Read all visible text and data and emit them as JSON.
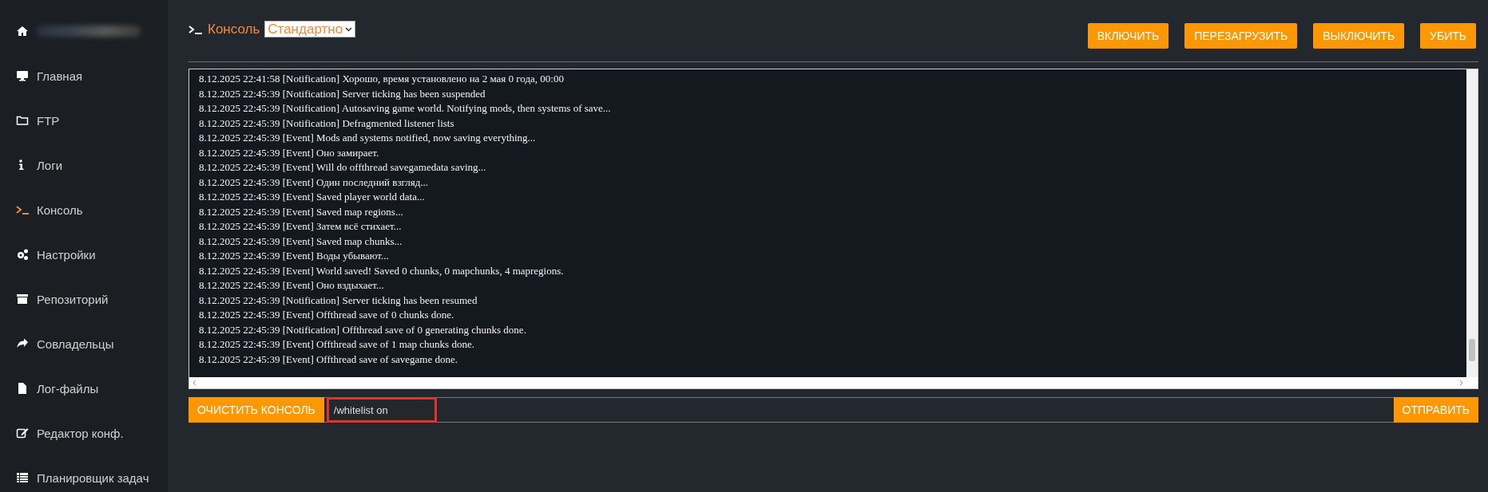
{
  "sidebar": {
    "items": [
      {
        "selected": false
      },
      {
        "label": "Главная",
        "selected": false
      },
      {
        "label": "FTP",
        "selected": false
      },
      {
        "label": "Логи",
        "selected": false
      },
      {
        "label": "Консоль",
        "selected": true
      },
      {
        "label": "Настройки",
        "selected": false
      },
      {
        "label": "Репозиторий",
        "selected": false
      },
      {
        "label": "Совладельцы",
        "selected": false
      },
      {
        "label": "Лог-файлы",
        "selected": false
      },
      {
        "label": "Редактор конф.",
        "selected": false
      },
      {
        "label": "Планировщик задач",
        "selected": false
      }
    ]
  },
  "header": {
    "title": "Консоль",
    "mode_select": {
      "value": "Стандартно"
    },
    "buttons": [
      "ВКЛЮЧИТЬ",
      "ПЕРЕЗАГРУЗИТЬ",
      "ВЫКЛЮЧИТЬ",
      "УБИТЬ"
    ]
  },
  "console": {
    "lines": [
      "8.12.2025 22:41:58 [Notification] Хорошо, время установлено на 2 мая 0 года, 00:00",
      "8.12.2025 22:45:39 [Notification] Server ticking has been suspended",
      "8.12.2025 22:45:39 [Notification] Autosaving game world. Notifying mods, then systems of save...",
      "8.12.2025 22:45:39 [Notification] Defragmented listener lists",
      "8.12.2025 22:45:39 [Event] Mods and systems notified, now saving everything...",
      "8.12.2025 22:45:39 [Event] Оно замирает.",
      "8.12.2025 22:45:39 [Event] Will do offthread savegamedata saving...",
      "8.12.2025 22:45:39 [Event] Один последний взгляд...",
      "8.12.2025 22:45:39 [Event] Saved player world data...",
      "8.12.2025 22:45:39 [Event] Saved map regions...",
      "8.12.2025 22:45:39 [Event] Затем всё стихает...",
      "8.12.2025 22:45:39 [Event] Saved map chunks...",
      "8.12.2025 22:45:39 [Event] Воды убывают...",
      "8.12.2025 22:45:39 [Event] World saved! Saved 0 chunks, 0 mapchunks, 4 mapregions.",
      "8.12.2025 22:45:39 [Event] Оно вздыхает...",
      "8.12.2025 22:45:39 [Notification] Server ticking has been resumed",
      "8.12.2025 22:45:39 [Event] Offthread save of 0 chunks done.",
      "8.12.2025 22:45:39 [Notification] Offthread save of 0 generating chunks done.",
      "8.12.2025 22:45:39 [Event] Offthread save of 1 map chunks done.",
      "8.12.2025 22:45:39 [Event] Offthread save of savegame done."
    ]
  },
  "command_bar": {
    "clear_button": "ОЧИСТИТЬ КОНСОЛЬ",
    "command": {
      "value": "/whitelist on"
    },
    "send_button": "ОТПРАВИТЬ"
  }
}
